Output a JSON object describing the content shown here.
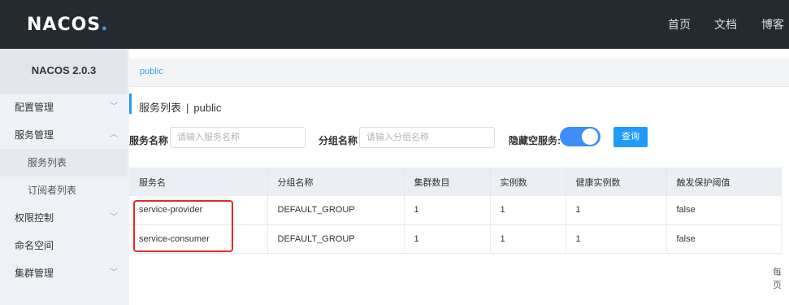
{
  "header": {
    "logo_text": "NACOS",
    "logo_dot": ".",
    "nav": [
      "首页",
      "文档",
      "博客"
    ]
  },
  "sidebar": {
    "version": "NACOS 2.0.3",
    "items": [
      {
        "label": "配置管理",
        "chevron": "﹀"
      },
      {
        "label": "服务管理",
        "chevron": "︿"
      },
      {
        "label": "服务列表"
      },
      {
        "label": "订阅者列表"
      },
      {
        "label": "权限控制",
        "chevron": "﹀"
      },
      {
        "label": "命名空间"
      },
      {
        "label": "集群管理",
        "chevron": "﹀"
      }
    ]
  },
  "breadcrumb": "public",
  "title": {
    "main": "服务列表",
    "sep": "|",
    "ns": "public"
  },
  "filters": {
    "service_label": "服务名称",
    "service_placeholder": "请输入服务名称",
    "group_label": "分组名称",
    "group_placeholder": "请输入分组名称",
    "hide_empty_label": "隐藏空服务:",
    "query_button": "查询"
  },
  "table": {
    "headers": [
      "服务名",
      "分组名称",
      "集群数目",
      "实例数",
      "健康实例数",
      "触发保护阈值"
    ],
    "rows": [
      [
        "service-provider",
        "DEFAULT_GROUP",
        "1",
        "1",
        "1",
        "false"
      ],
      [
        "service-consumer",
        "DEFAULT_GROUP",
        "1",
        "1",
        "1",
        "false"
      ]
    ]
  },
  "pager_text": "每页",
  "colors": {
    "header_bg": "#252a2f",
    "accent": "#209bfa",
    "highlight": "#e42a2a"
  }
}
